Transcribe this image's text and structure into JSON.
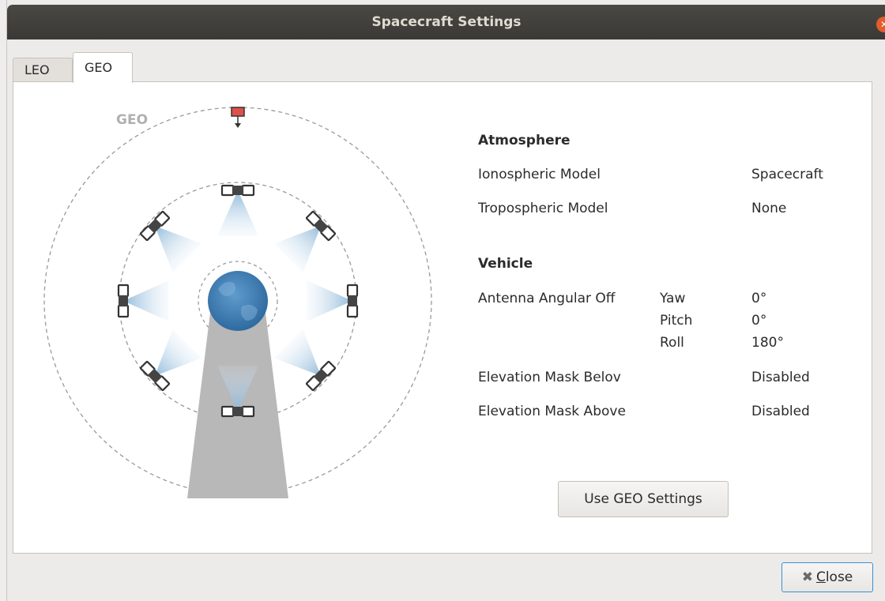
{
  "window": {
    "title": "Spacecraft Settings"
  },
  "tabs": [
    {
      "label": "LEO",
      "active": false
    },
    {
      "label": "GEO",
      "active": true
    }
  ],
  "diagram": {
    "orbit_label": "GEO"
  },
  "atmosphere": {
    "heading": "Atmosphere",
    "ionospheric_label": "Ionospheric Model",
    "ionospheric_value": "Spacecraft",
    "tropospheric_label": "Tropospheric Model",
    "tropospheric_value": "None"
  },
  "vehicle": {
    "heading": "Vehicle",
    "antenna_label": "Antenna Angular Off",
    "yaw_label": "Yaw",
    "yaw_value": "0°",
    "pitch_label": "Pitch",
    "pitch_value": "0°",
    "roll_label": "Roll",
    "roll_value": "180°",
    "mask_below_label": "Elevation Mask Belov",
    "mask_below_value": "Disabled",
    "mask_above_label": "Elevation Mask Above",
    "mask_above_value": "Disabled"
  },
  "buttons": {
    "use_geo_label": "Use GEO Settings",
    "close_mnemonic": "C",
    "close_rest": "lose"
  },
  "colors": {
    "titlebar": "#3f3e3a",
    "close_circle": "#e25c2c",
    "focus_border": "#3b8fd6",
    "marker": "#e0504a"
  },
  "icons": {
    "close_window": "close-circle-icon",
    "close_button": "x-icon",
    "earth": "globe-icon",
    "satellite": "satellite-icon"
  }
}
